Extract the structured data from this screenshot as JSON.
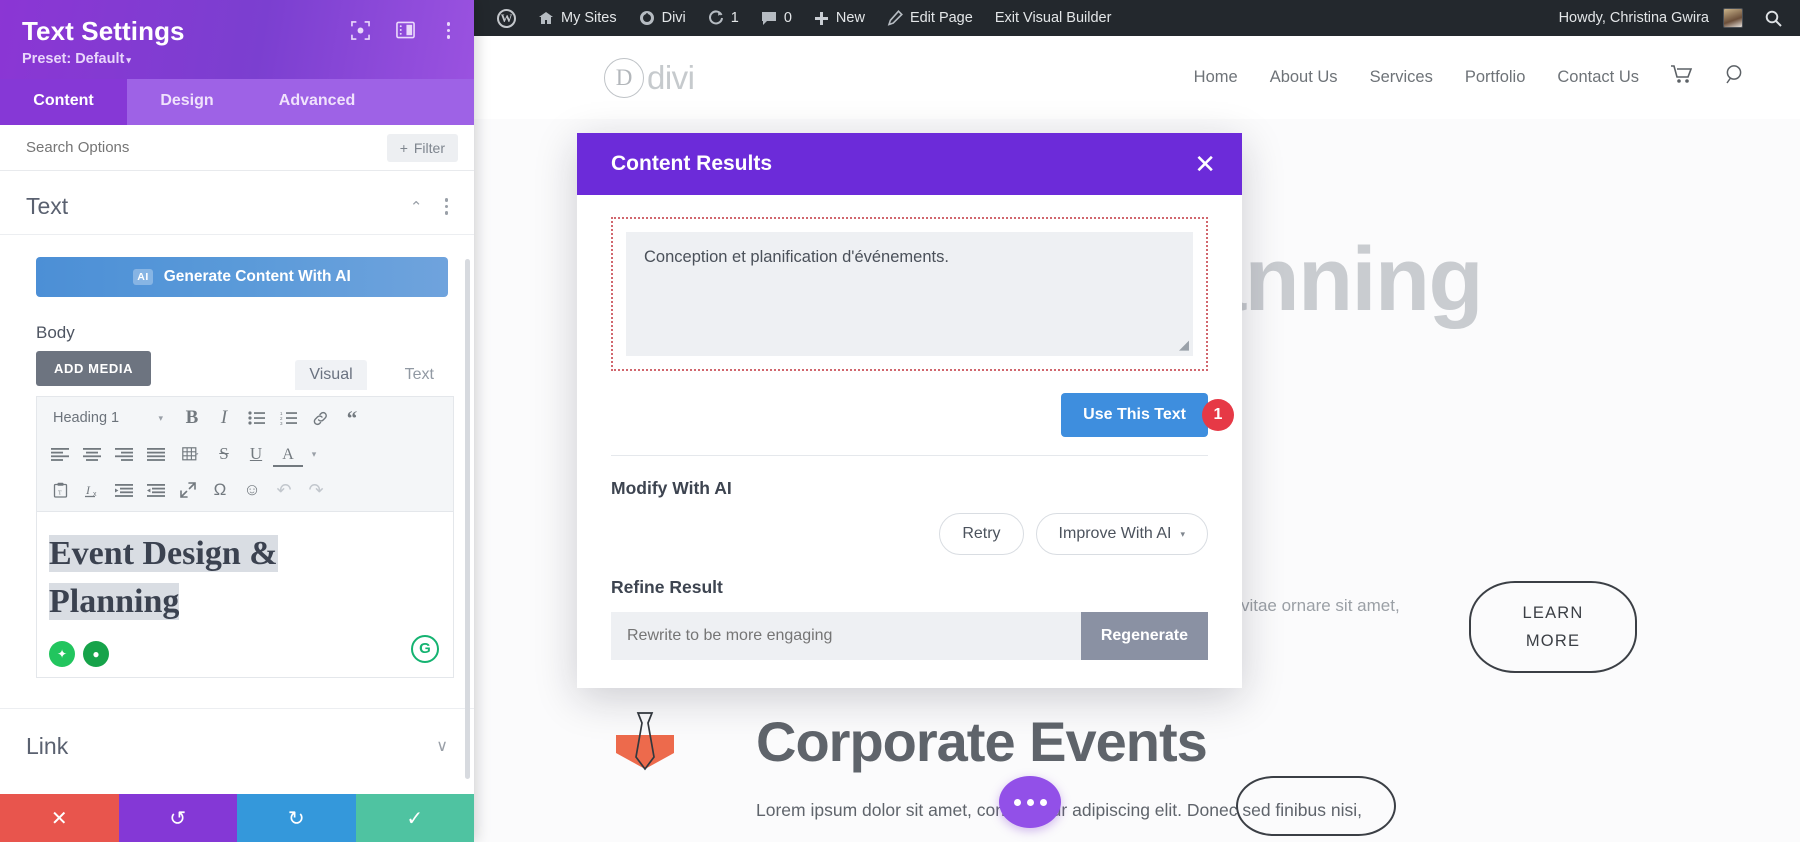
{
  "settings_panel": {
    "title": "Text Settings",
    "preset": "Preset: Default",
    "preset_caret": "▾",
    "header_icons": {
      "focus": "focus-icon",
      "layout": "layout-icon",
      "more": "more-icon"
    },
    "tabs": [
      {
        "key": "content",
        "label": "Content",
        "active": true
      },
      {
        "key": "design",
        "label": "Design",
        "active": false
      },
      {
        "key": "advanced",
        "label": "Advanced",
        "active": false
      }
    ],
    "search_placeholder": "Search Options",
    "filter_label": "Filter",
    "filter_plus": "+",
    "section": {
      "title": "Text",
      "chevron": "⌃"
    },
    "ai_button": {
      "chip": "AI",
      "label": "Generate Content With AI"
    },
    "body_label": "Body",
    "add_media_label": "ADD MEDIA",
    "editor_tabs": [
      {
        "label": "Visual",
        "active": true
      },
      {
        "label": "Text",
        "active": false
      }
    ],
    "format_select": {
      "value": "Heading 1",
      "caret": "▾"
    },
    "toolbar_row1": [
      {
        "name": "bold-icon",
        "glyph": "B"
      },
      {
        "name": "italic-icon",
        "glyph": "I"
      },
      {
        "name": "bulleted-list-icon",
        "glyph": "☰"
      },
      {
        "name": "numbered-list-icon",
        "glyph": "≡"
      },
      {
        "name": "link-icon",
        "glyph": "🔗"
      },
      {
        "name": "blockquote-icon",
        "glyph": "“"
      }
    ],
    "toolbar_row2": [
      {
        "name": "align-left-icon",
        "glyph": "≡"
      },
      {
        "name": "align-center-icon",
        "glyph": "≡"
      },
      {
        "name": "align-right-icon",
        "glyph": "≡"
      },
      {
        "name": "align-justify-icon",
        "glyph": "≡"
      },
      {
        "name": "table-icon",
        "glyph": "▦"
      },
      {
        "name": "strikethrough-icon",
        "glyph": "S"
      },
      {
        "name": "underline-icon",
        "glyph": "U"
      },
      {
        "name": "text-color-icon",
        "glyph": "A"
      }
    ],
    "toolbar_row3": [
      {
        "name": "paste-as-text-icon",
        "glyph": "📋"
      },
      {
        "name": "clear-formatting-icon",
        "glyph": "Iₓ"
      },
      {
        "name": "outdent-icon",
        "glyph": "≡"
      },
      {
        "name": "indent-icon",
        "glyph": "≡"
      },
      {
        "name": "fullscreen-icon",
        "glyph": "⤢"
      },
      {
        "name": "special-character-icon",
        "glyph": "Ω"
      },
      {
        "name": "emoji-icon",
        "glyph": "☺"
      },
      {
        "name": "undo-icon",
        "glyph": "↶"
      },
      {
        "name": "redo-icon",
        "glyph": "↷"
      }
    ],
    "editor_content_line1": "Event Design &",
    "editor_content_line2": "Planning",
    "grammarly_glyph": "G",
    "link_section": {
      "title": "Link",
      "chevron": "∨"
    },
    "footer": [
      {
        "name": "cancel-button",
        "glyph": "✕"
      },
      {
        "name": "undo-button",
        "glyph": "↺"
      },
      {
        "name": "redo-button",
        "glyph": "↻"
      },
      {
        "name": "save-button",
        "glyph": "✓"
      }
    ]
  },
  "admin_bar": {
    "wp_logo": "W",
    "items": [
      {
        "name": "my-sites",
        "label": "My Sites",
        "icon": "sites-icon"
      },
      {
        "name": "divi",
        "label": "Divi",
        "icon": "divi-icon"
      },
      {
        "name": "updates",
        "label": "1",
        "icon": "updates-icon"
      },
      {
        "name": "comments",
        "label": "0",
        "icon": "comments-icon"
      },
      {
        "name": "new",
        "label": "New",
        "icon": "plus-icon"
      },
      {
        "name": "edit-page",
        "label": "Edit Page",
        "icon": "pencil-icon"
      },
      {
        "name": "exit-visual-builder",
        "label": "Exit Visual Builder",
        "icon": ""
      }
    ],
    "howdy": "Howdy, Christina Gwira",
    "search_icon": "search-icon"
  },
  "site_header": {
    "logo_letter": "D",
    "logo_word": "divi",
    "nav": [
      "Home",
      "About Us",
      "Services",
      "Portfolio",
      "Contact Us"
    ],
    "cart_icon": "cart-icon",
    "search_icon": "search-icon"
  },
  "page": {
    "hero_title": "Planning",
    "hero_paragraph": "orci. Sed vitae nulla et ices vitae ornare sit amet, congue nec eu risus.",
    "learn_more_line1": "LEARN",
    "learn_more_line2": "MORE",
    "corporate_title": "Corporate Events",
    "corporate_paragraph": "Lorem ipsum dolor sit amet, consectetur adipiscing elit. Donec sed finibus nisi,",
    "tie_icon": "tie-icon",
    "dots_button": "more-options-icon"
  },
  "modal": {
    "title": "Content Results",
    "close_icon": "close-icon",
    "result_text": "Conception et planification d'événements.",
    "resize_glyph": "◢",
    "use_this_text_label": "Use This Text",
    "step_badge": "1",
    "modify_label": "Modify With AI",
    "retry_label": "Retry",
    "improve_label": "Improve With AI",
    "improve_caret": "▾",
    "refine_label": "Refine Result",
    "refine_placeholder": "Rewrite to be more engaging",
    "regenerate_label": "Regenerate"
  },
  "colors": {
    "panel_purple": "#8b36d4",
    "modal_purple": "#6c2bd9",
    "accent_blue": "#3e8ede",
    "badge_red": "#e63946",
    "dotted_border": "#d1676e"
  }
}
